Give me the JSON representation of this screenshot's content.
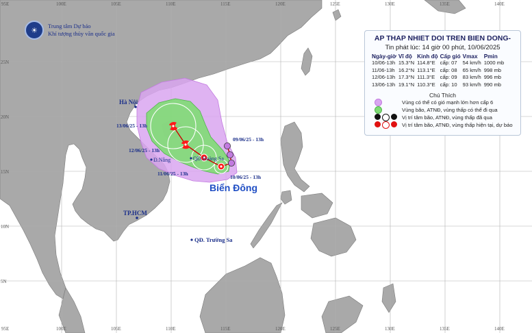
{
  "map": {
    "lon_labels": [
      "95E",
      "100E",
      "105E",
      "110E",
      "115E",
      "120E",
      "125E",
      "130E",
      "135E",
      "140E"
    ],
    "lat_labels": [
      "25N",
      "20N",
      "15N",
      "10N",
      "5N"
    ],
    "colors": {
      "sea": "#ffffff",
      "land": "#a9a9a9",
      "grid": "#b0b0b0",
      "wind_area": "#d9a6f0",
      "storm_area": "#7fdc74",
      "track": "#cc0000"
    }
  },
  "organization": {
    "line1": "Trung tâm Dự báo",
    "line2": "Khí tượng thủy văn quốc gia"
  },
  "places": {
    "hanoi": "Hà Nội",
    "danang": "Đ.Nẵng",
    "hcm": "TP.HCM",
    "hoangsa": "QĐ.Hoàng Sa",
    "truongsa": "QĐ. Trường Sa",
    "biendong": "Biển Đông"
  },
  "track_labels": [
    "09/06/25 - 13h",
    "10/06/25 - 13h",
    "11/06/25 - 13h",
    "12/06/25 - 13h",
    "13/06/25 - 13h"
  ],
  "bulletin": {
    "title": "AP THAP NHIET DOI TREN BIEN DONG-",
    "issued": "Tin phát lúc: 14 giờ 00 phút, 10/06/2025",
    "columns": [
      "Ngày-giờ",
      "Vĩ độ",
      "Kinh độ",
      "Cấp gió",
      "Vmax",
      "Pmin"
    ],
    "rows": [
      [
        "10/06-13h",
        "15.3°N",
        "114.8°E",
        "cấp: 07",
        "54 km/h",
        "1000 mb"
      ],
      [
        "11/06-13h",
        "16.2°N",
        "113.1°E",
        "cấp: 08",
        "65 km/h",
        "998 mb"
      ],
      [
        "12/06-13h",
        "17.3°N",
        "111.3°E",
        "cấp: 09",
        "83 km/h",
        "996 mb"
      ],
      [
        "13/06-13h",
        "19.1°N",
        "110.3°E",
        "cấp: 10",
        "93 km/h",
        "990 mb"
      ]
    ]
  },
  "legend": {
    "title": "Chú Thích",
    "items": [
      "Vùng có thể có gió mạnh lớn hơn cấp 6",
      "Vùng bão, ATNĐ, vùng thấp có thể đi qua",
      "Vị trí tâm bão, ATNĐ, vùng thấp đã qua",
      "Vị trí tâm bão, ATNĐ, vùng thấp hiện tại, dự báo"
    ]
  }
}
